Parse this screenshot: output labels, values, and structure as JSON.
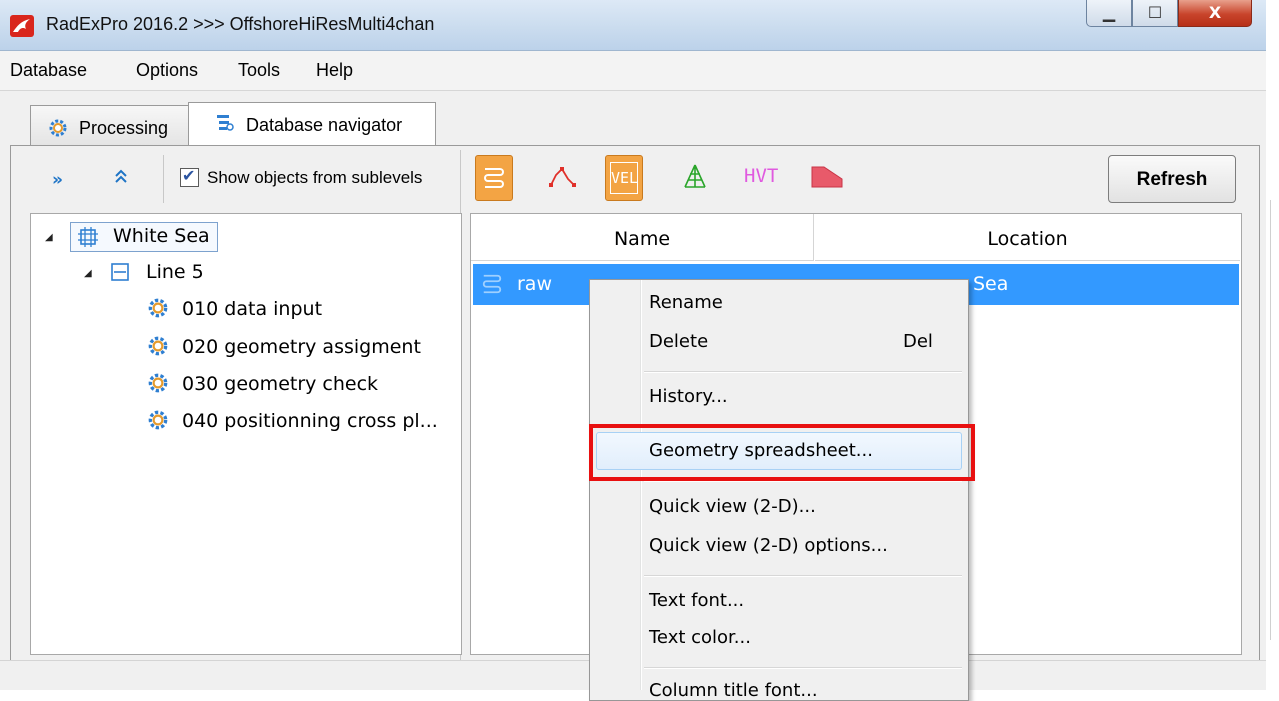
{
  "window": {
    "title": "RadExPro 2016.2 >>> OffshoreHiResMulti4chan",
    "controls": {
      "minimize": "▁",
      "maximize": "☐",
      "close": "X"
    }
  },
  "menubar": [
    "Database",
    "Options",
    "Tools",
    "Help"
  ],
  "tabs": [
    {
      "label": "Processing",
      "active": false,
      "icon": "gear-icon"
    },
    {
      "label": "Database navigator",
      "active": true,
      "icon": "database-navigator-icon"
    }
  ],
  "left_toolbar": {
    "expand_icon": "»",
    "collapse_icon": "⌃",
    "show_sublevels_checked": true,
    "show_sublevels_label": "Show objects from sublevels"
  },
  "tree": {
    "root": {
      "label": "White Sea",
      "icon": "area-icon",
      "expanded": true
    },
    "line": {
      "label": "Line 5",
      "icon": "line-icon",
      "expanded": true
    },
    "flows": [
      "010 data input",
      "020 geometry assigment",
      "030 geometry check",
      "040 positionning cross pl..."
    ]
  },
  "right_toolbar": {
    "filters": [
      {
        "name": "seismic-data-filter",
        "selected": true,
        "color": "#f3a444"
      },
      {
        "name": "pick-filter",
        "selected": false,
        "color": "#e0302a"
      },
      {
        "name": "velocity-filter",
        "label": "VEL",
        "selected": true,
        "color": "#f3a444"
      },
      {
        "name": "grid-filter",
        "selected": false,
        "color": "#2aa52a"
      },
      {
        "name": "hvt-filter",
        "label": "HVT",
        "selected": false,
        "color": "#e05adf"
      },
      {
        "name": "polygon-filter",
        "selected": false,
        "color": "#e85a6a"
      }
    ],
    "refresh_label": "Refresh"
  },
  "table": {
    "columns": [
      "Name",
      "Location"
    ],
    "rows": [
      {
        "name": "raw",
        "location": "Sea",
        "selected": true
      }
    ]
  },
  "context_menu": {
    "items": [
      {
        "label": "Rename"
      },
      {
        "label": "Delete",
        "shortcut": "Del"
      },
      {
        "label": "History..."
      },
      {
        "label": "Geometry spreadsheet...",
        "hovered": true,
        "highlighted": true
      },
      {
        "label": "Quick view (2-D)..."
      },
      {
        "label": "Quick view (2-D) options..."
      },
      {
        "label": "Text font..."
      },
      {
        "label": "Text color..."
      },
      {
        "label": "Column title font..."
      }
    ],
    "highlight_color": "#e81010"
  }
}
